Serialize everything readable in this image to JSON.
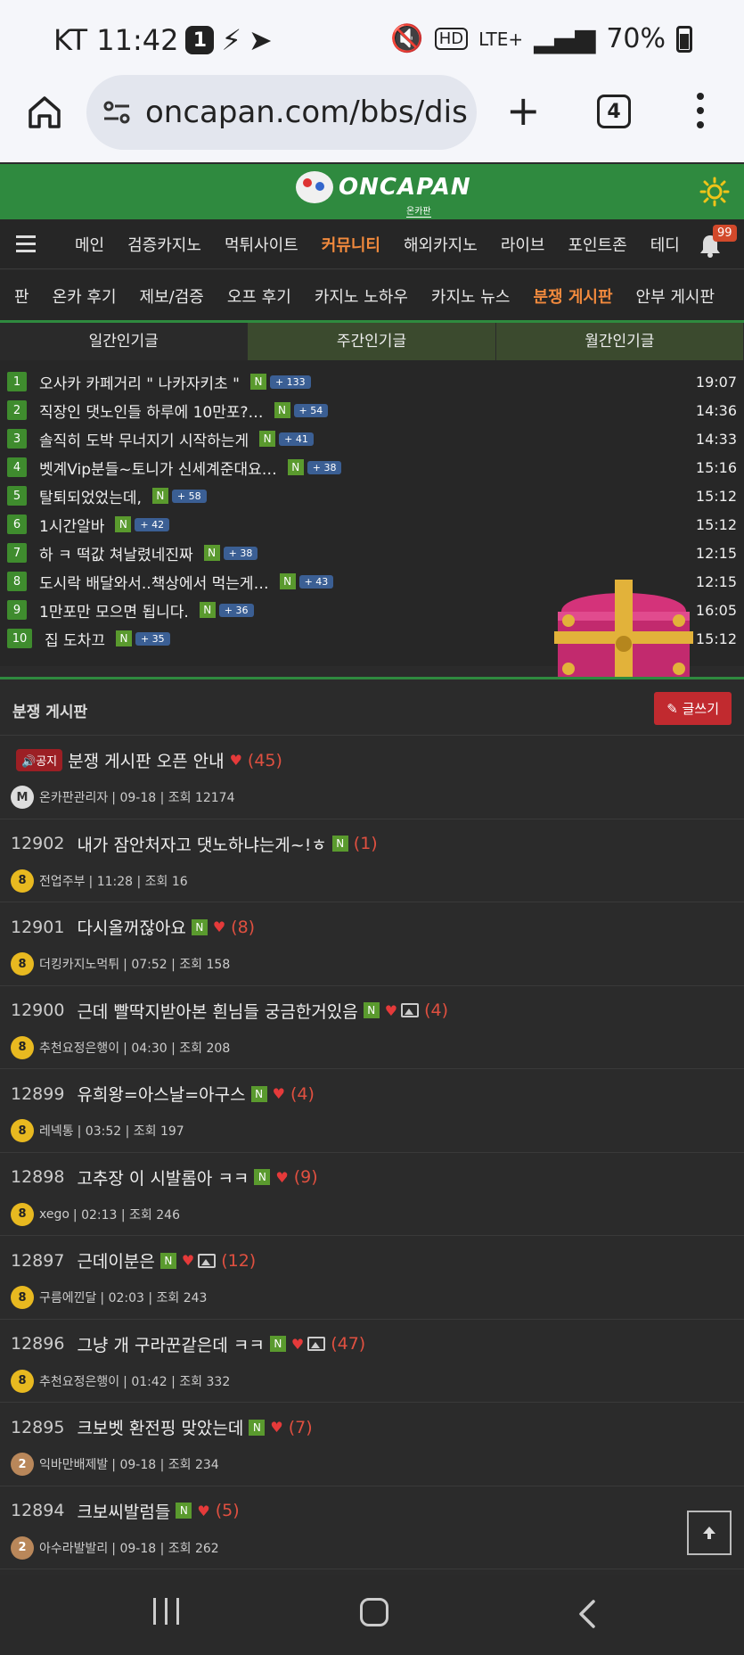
{
  "status": {
    "carrier_time": "KT 11:42",
    "notif_count": "1",
    "network": "LTE+",
    "battery": "70%"
  },
  "browser": {
    "url": "oncapan.com/bbs/dis",
    "tab_count": "4"
  },
  "site": {
    "logo": "ONCAPAN",
    "logo_sub": "온카판"
  },
  "main_nav": {
    "items": [
      "메인",
      "검증카지노",
      "먹튀사이트",
      "커뮤니티",
      "해외카지노",
      "라이브",
      "포인트존",
      "테디"
    ],
    "active_index": 3,
    "bell_count": "99"
  },
  "sub_nav": {
    "items": [
      "판",
      "온카 후기",
      "제보/검증",
      "오프 후기",
      "카지노 노하우",
      "카지노 뉴스",
      "분쟁 게시판",
      "안부 게시판"
    ],
    "active_index": 6
  },
  "popular": {
    "tabs": [
      "일간인기글",
      "주간인기글",
      "월간인기글"
    ],
    "items": [
      {
        "rank": "1",
        "title": "오사카 카페거리 \" 나카자키초 \"",
        "count": "+ 133",
        "time": "19:07"
      },
      {
        "rank": "2",
        "title": "직장인 댓노인들 하루에 10만포?…",
        "count": "+ 54",
        "time": "14:36"
      },
      {
        "rank": "3",
        "title": "솔직히 도박 무너지기 시작하는게",
        "count": "+ 41",
        "time": "14:33"
      },
      {
        "rank": "4",
        "title": "벳계Vip분들~토니가 신세계준대요…",
        "count": "+ 38",
        "time": "15:16"
      },
      {
        "rank": "5",
        "title": "탈퇴되었었는데,",
        "count": "+ 58",
        "time": "15:12"
      },
      {
        "rank": "6",
        "title": "1시간알바",
        "count": "+ 42",
        "time": "15:12"
      },
      {
        "rank": "7",
        "title": "하 ㅋ 떡값 쳐날렸네진짜",
        "count": "+ 38",
        "time": "12:15"
      },
      {
        "rank": "8",
        "title": "도시락 배달와서..책상에서 먹는게…",
        "count": "+ 43",
        "time": "12:15"
      },
      {
        "rank": "9",
        "title": "1만포만 모으면 됩니다.",
        "count": "+ 36",
        "time": "16:05"
      },
      {
        "rank": "10",
        "title": "집 도차끄",
        "count": "+ 35",
        "time": "15:12"
      }
    ]
  },
  "board": {
    "title": "분쟁 게시판",
    "write_label": "글쓰기",
    "notice_label": "공지",
    "posts": [
      {
        "num": "",
        "notice": true,
        "title": "분쟁 게시판 오픈 안내",
        "replies": "(45)",
        "level": "M",
        "author": "온카판관리자",
        "meta": "| 09-18 | 조회 12174",
        "is_new": false,
        "has_img": false
      },
      {
        "num": "12902",
        "title": "내가 잠안처자고 댓노하냐는게~!ㅎ",
        "replies": "(1)",
        "level": "8",
        "author": "전업주부",
        "meta": "| 11:28 | 조회 16",
        "is_new": true,
        "has_heart": false,
        "has_img": false
      },
      {
        "num": "12901",
        "title": "다시올꺼잖아요",
        "replies": "(8)",
        "level": "8",
        "author": "더킹카지노먹튀",
        "meta": "| 07:52 | 조회 158",
        "is_new": true,
        "has_heart": true,
        "has_img": false
      },
      {
        "num": "12900",
        "title": "근데 빨딱지받아본 흰님들 궁금한거있음",
        "replies": "(4)",
        "level": "8",
        "author": "추천요정은행이",
        "meta": "| 04:30 | 조회 208",
        "is_new": true,
        "has_heart": true,
        "has_img": true
      },
      {
        "num": "12899",
        "title": "유희왕=아스날=아구스",
        "replies": "(4)",
        "level": "8",
        "author": "레넥통",
        "meta": "| 03:52 | 조회 197",
        "is_new": true,
        "has_heart": true,
        "has_img": false
      },
      {
        "num": "12898",
        "title": "고추장 이 시발롬아 ㅋㅋ",
        "replies": "(9)",
        "level": "8",
        "author": "xego",
        "meta": "| 02:13 | 조회 246",
        "is_new": true,
        "has_heart": true,
        "has_img": false
      },
      {
        "num": "12897",
        "title": "근데이분은",
        "replies": "(12)",
        "level": "8",
        "author": "구름에낀달",
        "meta": "| 02:03 | 조회 243",
        "is_new": true,
        "has_heart": true,
        "has_img": true
      },
      {
        "num": "12896",
        "title": "그냥 개 구라꾼같은데 ㅋㅋ",
        "replies": "(47)",
        "level": "8",
        "author": "추천요정은행이",
        "meta": "| 01:42 | 조회 332",
        "is_new": true,
        "has_heart": true,
        "has_img": true
      },
      {
        "num": "12895",
        "title": "크보벳 환전핑 맞았는데",
        "replies": "(7)",
        "level": "2",
        "author": "익바만배제발",
        "meta": "| 09-18 | 조회 234",
        "is_new": true,
        "has_heart": true,
        "has_img": false
      },
      {
        "num": "12894",
        "title": "크보씨발럼들",
        "replies": "(5)",
        "level": "2",
        "author": "아수라발발리",
        "meta": "| 09-18 | 조회 262",
        "is_new": true,
        "has_heart": true,
        "has_img": false
      }
    ]
  },
  "colors": {
    "brand_green": "#2f8a3f",
    "accent_orange": "#f28a3d",
    "reply_red": "#e05040",
    "notice_red": "#9c1f24"
  }
}
